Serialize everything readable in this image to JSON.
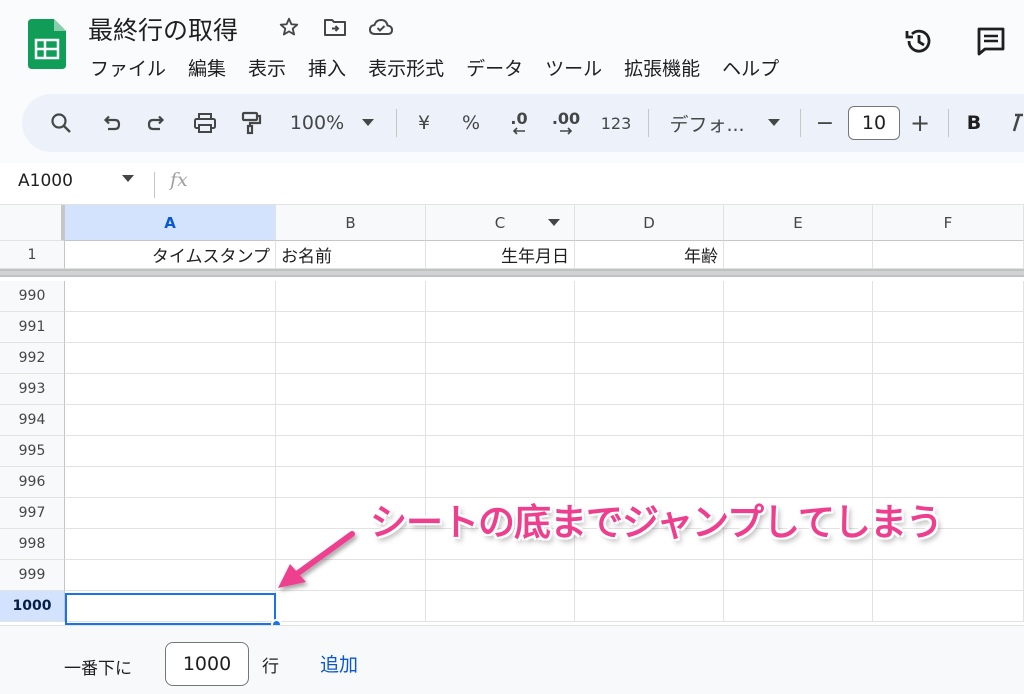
{
  "header": {
    "title": "最終行の取得",
    "menu": [
      "ファイル",
      "編集",
      "表示",
      "挿入",
      "表示形式",
      "データ",
      "ツール",
      "拡張機能",
      "ヘルプ"
    ]
  },
  "toolbar": {
    "zoom": "100%",
    "currency": "¥",
    "percent": "%",
    "decimal_decrease": ".0",
    "decimal_increase": ".00",
    "number_format": "123",
    "font": "デフォ...",
    "font_size": "10",
    "minus": "−",
    "plus": "+",
    "bold": "B"
  },
  "formula_bar": {
    "name_box": "A1000",
    "fx": "fx"
  },
  "grid": {
    "columns": [
      "A",
      "B",
      "C",
      "D",
      "E",
      "F"
    ],
    "header_row": {
      "number": "1",
      "cells": [
        "タイムスタンプ",
        "お名前",
        "生年月日",
        "年齢",
        "",
        ""
      ]
    },
    "rows": [
      "990",
      "991",
      "992",
      "993",
      "994",
      "995",
      "996",
      "997",
      "998",
      "999",
      "1000"
    ],
    "selected_row": "1000",
    "selected_column": "A"
  },
  "bottom_bar": {
    "label": "一番下に",
    "value": "1000",
    "unit": "行",
    "add_link": "追加"
  },
  "annotation": {
    "text": "シートの底までジャンプしてしまう",
    "color": "#ee3f8f"
  },
  "colors": {
    "accent": "#1a73e8",
    "sheets_green": "#0f9d58",
    "link": "#0b57d0"
  }
}
